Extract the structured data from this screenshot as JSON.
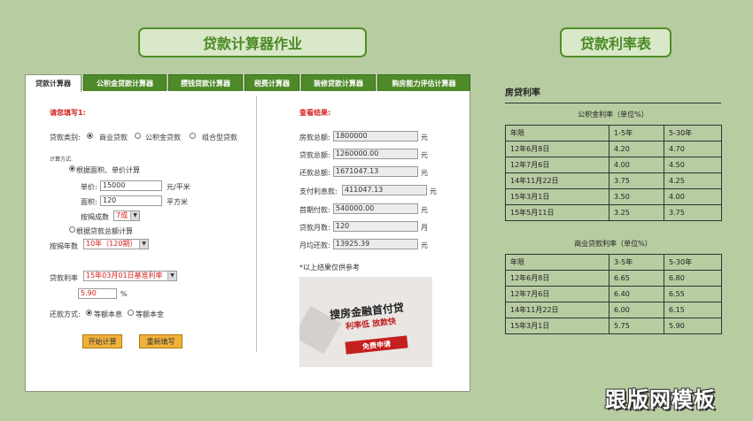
{
  "headings": {
    "calculator": "贷款计算器作业",
    "rates": "贷款利率表"
  },
  "tabs": [
    "贷款计算器",
    "公积金贷款计算器",
    "攒钱贷款计算器",
    "税费计算器",
    "装修贷款计算器",
    "购房能力评估计算器"
  ],
  "form": {
    "fill_title": "请您填写1:",
    "loan_type_label": "贷款类别:",
    "loan_types": [
      "商业贷款",
      "公积金贷款",
      "组合型贷款"
    ],
    "calc_method_label": "计算方式:",
    "method_area": "根据面积、单价计算",
    "unit_price_label": "单价:",
    "unit_price_value": "15000",
    "unit_price_unit": "元/平米",
    "area_label": "面积:",
    "area_value": "120",
    "area_unit": "平方米",
    "mortgage_ratio_label": "按揭成数",
    "mortgage_ratio_value": "7成",
    "method_total": "根据贷款总额计算",
    "years_label": "按揭年数",
    "years_value": "10年（120期）",
    "rate_label": "贷款利率",
    "rate_select_value": "15年03月01日基准利率",
    "rate_value": "5.90",
    "rate_unit": "%",
    "repay_label": "还款方式:",
    "repay_options": [
      "等额本息",
      "等额本金"
    ],
    "start_button": "开始计算",
    "reset_button": "重新填写"
  },
  "results": {
    "title": "查看结果:",
    "rows": [
      {
        "label": "房款总额:",
        "value": "1800000",
        "unit": "元"
      },
      {
        "label": "贷款总额:",
        "value": "1260000.00",
        "unit": "元"
      },
      {
        "label": "还款总额:",
        "value": "1671047.13",
        "unit": "元"
      },
      {
        "label": "支付利息款:",
        "value": "411047.13",
        "unit": "元"
      },
      {
        "label": "首期付款:",
        "value": "540000.00",
        "unit": "元"
      },
      {
        "label": "贷款月数:",
        "value": "120",
        "unit": "月"
      },
      {
        "label": "月均还款:",
        "value": "13925.39",
        "unit": "元"
      }
    ],
    "note": "*以上结果仅供参考"
  },
  "ad": {
    "line1": "搜房金融首付贷",
    "line2": "利率低 放款快",
    "button": "免费申请"
  },
  "rate_table": {
    "title": "房贷利率",
    "provident": {
      "caption": "公积金利率（单位%）",
      "header": [
        "年限",
        "1-5年",
        "5-30年"
      ],
      "rows": [
        [
          "12年6月8日",
          "4.20",
          "4.70"
        ],
        [
          "12年7月6日",
          "4.00",
          "4.50"
        ],
        [
          "14年11月22日",
          "3.75",
          "4.25"
        ],
        [
          "15年3月1日",
          "3.50",
          "4.00"
        ],
        [
          "15年5月11日",
          "3.25",
          "3.75"
        ]
      ]
    },
    "commercial": {
      "caption": "商业贷款利率（单位%）",
      "header": [
        "年限",
        "3-5年",
        "5-30年"
      ],
      "rows": [
        [
          "12年6月8日",
          "6.65",
          "6.80"
        ],
        [
          "12年7月6日",
          "6.40",
          "6.55"
        ],
        [
          "14年11月22日",
          "6.00",
          "6.15"
        ],
        [
          "15年3月1日",
          "5.75",
          "5.90"
        ]
      ]
    }
  },
  "watermark": "跟版网模板"
}
